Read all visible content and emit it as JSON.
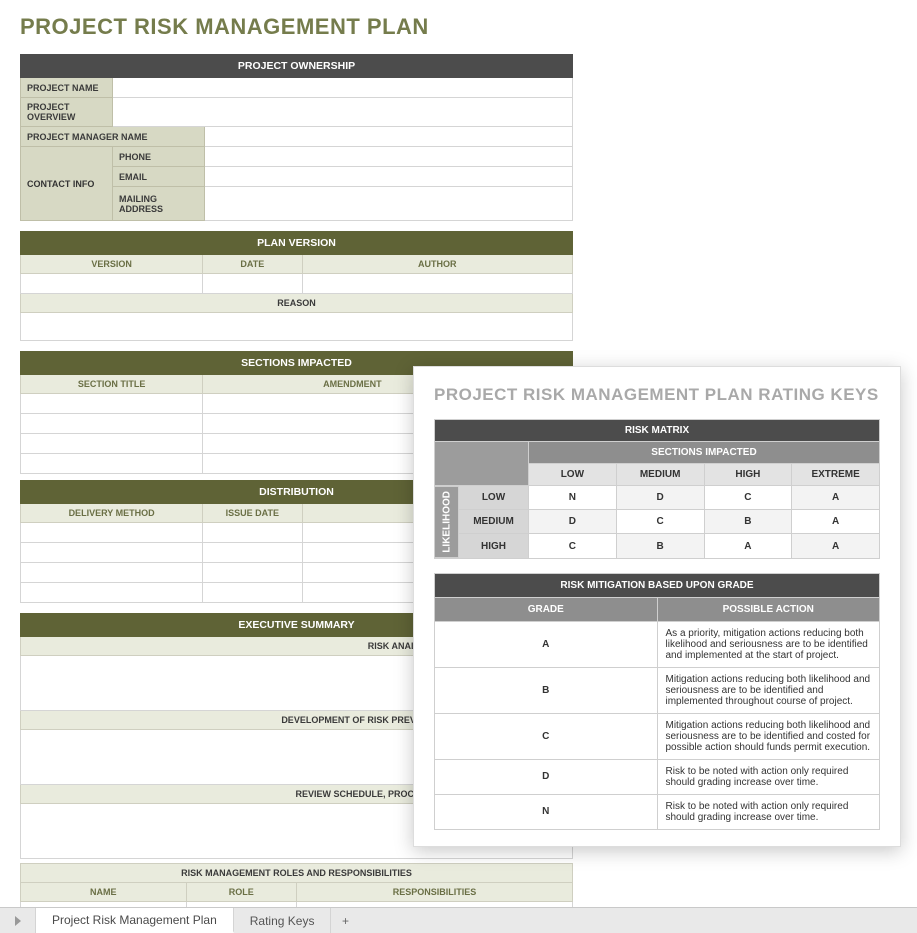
{
  "title": "PROJECT RISK MANAGEMENT PLAN",
  "ownership": {
    "header": "PROJECT OWNERSHIP",
    "project_name_label": "PROJECT NAME",
    "project_overview_label": "PROJECT OVERVIEW",
    "project_manager_label": "PROJECT MANAGER NAME",
    "contact_info_label": "CONTACT INFO",
    "phone_label": "PHONE",
    "email_label": "EMAIL",
    "mailing_label": "MAILING ADDRESS"
  },
  "plan_version": {
    "header": "PLAN VERSION",
    "version_label": "VERSION",
    "date_label": "DATE",
    "author_label": "AUTHOR",
    "reason_label": "REASON"
  },
  "sections_impacted": {
    "header": "SECTIONS IMPACTED",
    "section_title_label": "SECTION TITLE",
    "amendment_label": "AMENDMENT"
  },
  "distribution": {
    "header": "DISTRIBUTION",
    "delivery_label": "DELIVERY METHOD",
    "issue_date_label": "ISSUE DATE"
  },
  "exec": {
    "header": "EXECUTIVE SUMMARY",
    "risk_analysis_label": "RISK ANALYSIS AND EVALUATION PROCESS",
    "development_label": "DEVELOPMENT OF RISK PREVENTION MITIGATION STRATEGIES",
    "review_label": "REVIEW SCHEDULE, PROCESS, AND PARTIES RESPONSIBLE",
    "roles_header": "RISK MANAGEMENT ROLES AND RESPONSIBILITIES",
    "name_label": "NAME",
    "role_label": "ROLE",
    "resp_label": "RESPONSIBILITIES"
  },
  "tabs": {
    "tab1": "Project Risk Management Plan",
    "tab2": "Rating Keys",
    "add": "+"
  },
  "panel": {
    "title": "PROJECT RISK MANAGEMENT PLAN RATING KEYS",
    "matrix": {
      "header": "RISK MATRIX",
      "cols_header": "SECTIONS IMPACTED",
      "side_label": "LIKELIHOOD",
      "cols": [
        "LOW",
        "MEDIUM",
        "HIGH",
        "EXTREME"
      ],
      "rows": [
        "LOW",
        "MEDIUM",
        "HIGH"
      ],
      "cells": [
        [
          "N",
          "D",
          "C",
          "A"
        ],
        [
          "D",
          "C",
          "B",
          "A"
        ],
        [
          "C",
          "B",
          "A",
          "A"
        ]
      ]
    },
    "mitigation": {
      "header": "RISK MITIGATION BASED UPON GRADE",
      "grade_label": "GRADE",
      "action_label": "POSSIBLE ACTION",
      "rows": [
        {
          "grade": "A",
          "action": "As a priority, mitigation actions reducing both likelihood and seriousness are to be identified and implemented at the start of project."
        },
        {
          "grade": "B",
          "action": "Mitigation actions reducing both likelihood and seriousness are to be identified and implemented throughout course of project."
        },
        {
          "grade": "C",
          "action": "Mitigation actions reducing both likelihood and seriousness are to be identified and costed for possible action should funds permit execution."
        },
        {
          "grade": "D",
          "action": "Risk to be noted with action only required should grading increase over time."
        },
        {
          "grade": "N",
          "action": "Risk to be noted with action only required should grading increase over time."
        }
      ]
    }
  }
}
